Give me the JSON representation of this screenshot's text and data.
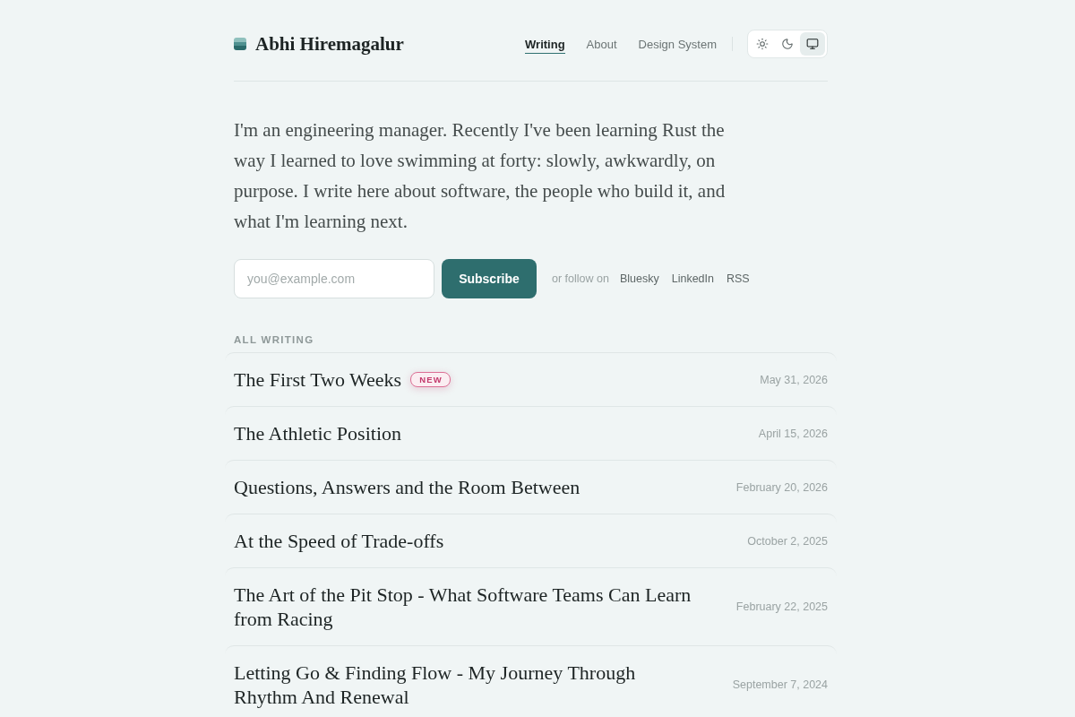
{
  "header": {
    "site_name": "Abhi Hiremagalur",
    "nav": [
      {
        "label": "Writing",
        "selected": true
      },
      {
        "label": "About",
        "selected": false
      },
      {
        "label": "Design System",
        "selected": false
      }
    ],
    "theme_options": [
      {
        "kind": "light",
        "selected": false
      },
      {
        "kind": "dark",
        "selected": false
      },
      {
        "kind": "system",
        "selected": true
      }
    ]
  },
  "intro": "I'm an engineering manager. Recently I've been learning Rust the way I learned to love swimming at forty: slowly, awkwardly, on purpose. I write here about software, the people who build it, and what I'm learning next.",
  "subscribe": {
    "placeholder": "you@example.com",
    "button": "Subscribe",
    "follow_label": "or follow on",
    "links": [
      "Bluesky",
      "LinkedIn",
      "RSS"
    ]
  },
  "posts": {
    "heading": "ALL WRITING",
    "items": [
      {
        "title": "The First Two Weeks",
        "badge": "NEW",
        "date": "May 31, 2026"
      },
      {
        "title": "The Athletic Position",
        "date": "April 15, 2026"
      },
      {
        "title": "Questions, Answers and the Room Between",
        "date": "February 20, 2026"
      },
      {
        "title": "At the Speed of Trade-offs",
        "date": "October 2, 2025"
      },
      {
        "title": "The Art of the Pit Stop - What Software Teams Can Learn from Racing",
        "date": "February 22, 2025"
      },
      {
        "title": "Letting Go & Finding Flow - My Journey Through Rhythm And Renewal",
        "date": "September 7, 2024"
      }
    ]
  }
}
